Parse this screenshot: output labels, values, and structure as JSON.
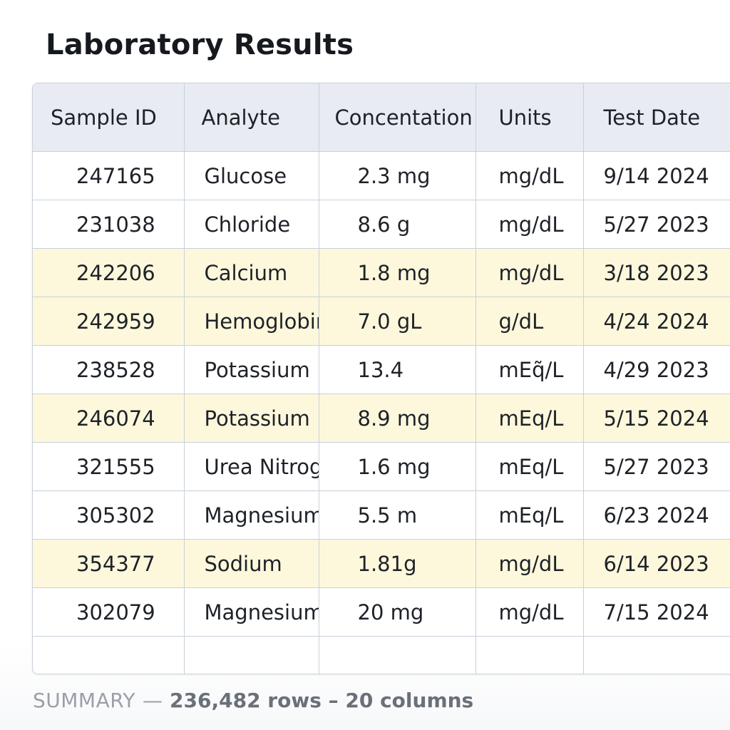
{
  "page": {
    "title": "Laboratory Results"
  },
  "table": {
    "columns": [
      "Sample ID",
      "Analyte",
      "Concentation",
      "Units",
      "Test Date"
    ],
    "rows": [
      {
        "sample_id": "247165",
        "analyte": "Glucose",
        "concentration": "2.3 mg",
        "units": "mg/dL",
        "test_date": "9/14 2024",
        "highlighted": false
      },
      {
        "sample_id": "231038",
        "analyte": "Chloride",
        "concentration": "8.6 g",
        "units": "mg/dL",
        "test_date": "5/27 2023",
        "highlighted": false
      },
      {
        "sample_id": "242206",
        "analyte": "Calcium",
        "concentration": "1.8 mg",
        "units": "mg/dL",
        "test_date": "3/18 2023",
        "highlighted": true
      },
      {
        "sample_id": "242959",
        "analyte": "Hemoglobin",
        "concentration": "7.0 gL",
        "units": "g/dL",
        "test_date": "4/24 2024",
        "highlighted": true
      },
      {
        "sample_id": "238528",
        "analyte": "Potassium",
        "concentration": "13.4",
        "units": "mEq̃/L",
        "test_date": "4/29 2023",
        "highlighted": false
      },
      {
        "sample_id": "246074",
        "analyte": "Potassium",
        "concentration": "8.9 mg",
        "units": "mEq/L",
        "test_date": "5/15 2024",
        "highlighted": true
      },
      {
        "sample_id": "321555",
        "analyte": "Urea Nitrogen",
        "concentration": "1.6 mg",
        "units": "mEq/L",
        "test_date": "5/27 2023",
        "highlighted": false
      },
      {
        "sample_id": "305302",
        "analyte": "Magnesium",
        "concentration": "5.5 m",
        "units": "mEq/L",
        "test_date": "6/23 2024",
        "highlighted": false
      },
      {
        "sample_id": "354377",
        "analyte": "Sodium",
        "concentration": "1.81g",
        "units": "mg/dL",
        "test_date": "6/14 2023",
        "highlighted": true
      },
      {
        "sample_id": "302079",
        "analyte": "Magnesium",
        "concentration": "20 mg",
        "units": "mg/dL",
        "test_date": "7/15 2024",
        "highlighted": false
      }
    ]
  },
  "summary": {
    "label": "SUMMARY",
    "separator": "—",
    "text": "236,482 rows – 20 columns"
  },
  "colors": {
    "header_bg": "#e8ecf2",
    "highlight_bg": "#fdf8dc",
    "border": "#c9d0da"
  }
}
